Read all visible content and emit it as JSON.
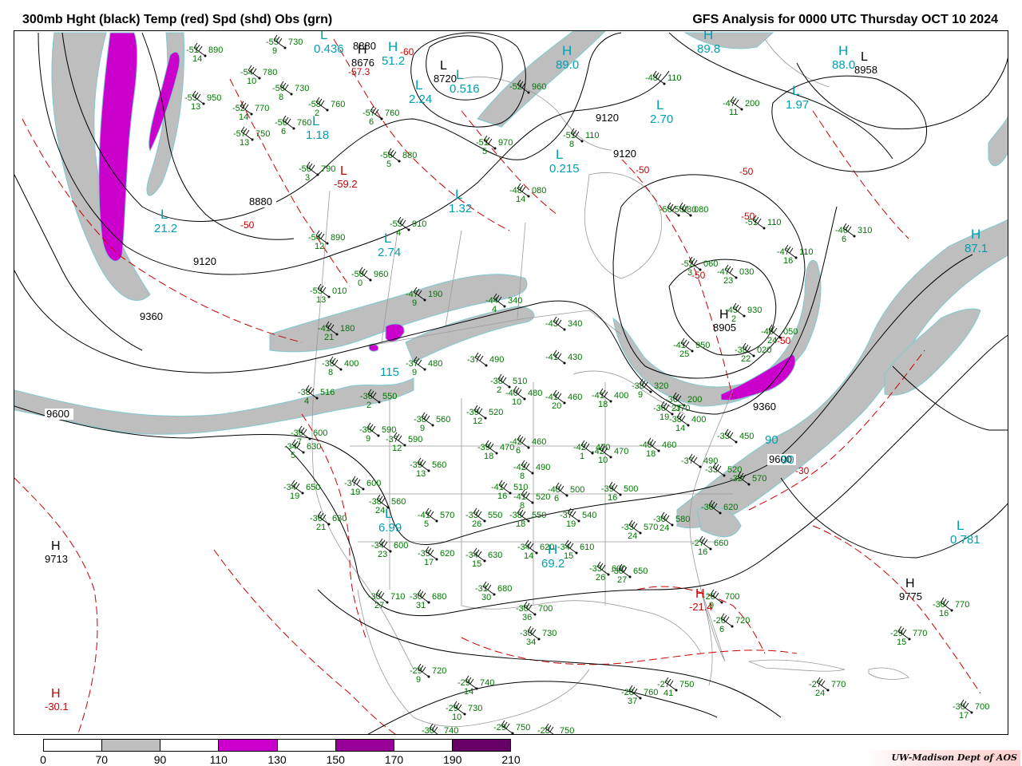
{
  "header": {
    "title_left": "300mb Hght (black) Temp (red) Spd (shd) Obs (grn)",
    "title_right": "GFS Analysis for 0000 UTC Thursday  OCT 10 2024"
  },
  "legend": {
    "labels": [
      "0",
      "70",
      "90",
      "110",
      "130",
      "150",
      "170",
      "190",
      "210"
    ],
    "colors": [
      "#ffffff",
      "#bebebe",
      "#ffffff",
      "#cc00cc",
      "#ffffff",
      "#990099",
      "#ffffff",
      "#660066"
    ]
  },
  "credit": "UW-Madison   Dept of AOS",
  "colors": {
    "height": "#000000",
    "temp": "#cc0000",
    "speed_label": "#00a0b0",
    "obs": "#007700",
    "boundary": "#999999"
  },
  "height_labels": [
    "8880",
    "9120",
    "9360",
    "9600",
    "9120",
    "9120",
    "8880",
    "9360",
    "9600"
  ],
  "centers": [
    {
      "type": "H",
      "value": "9713",
      "color": "black"
    },
    {
      "type": "H",
      "value": "9775",
      "color": "black"
    },
    {
      "type": "H",
      "value": "-30.1",
      "color": "red"
    },
    {
      "type": "L",
      "value": "8958",
      "color": "black"
    },
    {
      "type": "H",
      "value": "8905",
      "color": "black"
    },
    {
      "type": "L",
      "value": "8720",
      "color": "black"
    },
    {
      "type": "H",
      "value": "8676",
      "color": "black"
    },
    {
      "type": "H",
      "value": "-21.4",
      "color": "red"
    },
    {
      "type": "L",
      "value": "-59.2",
      "color": "red"
    }
  ],
  "speed_centers": [
    {
      "type": "L",
      "value": "21.2"
    },
    {
      "type": "L",
      "value": "2.74"
    },
    {
      "type": "L",
      "value": "1.18"
    },
    {
      "type": "L",
      "value": "2.24"
    },
    {
      "type": "L",
      "value": "1.32"
    },
    {
      "type": "L",
      "value": "0.215"
    },
    {
      "type": "L",
      "value": "2.70"
    },
    {
      "type": "L",
      "value": "1.97"
    },
    {
      "type": "H",
      "value": "88.0"
    },
    {
      "type": "H",
      "value": "89.0"
    },
    {
      "type": "H",
      "value": "87.1"
    },
    {
      "type": "L",
      "value": "6.99"
    },
    {
      "type": "H",
      "value": "69.2"
    },
    {
      "type": "L",
      "value": "0.781"
    },
    {
      "type": "H",
      "value": "51.2"
    },
    {
      "type": "L",
      "value": "0.436"
    },
    {
      "type": "L",
      "value": "0.516"
    },
    {
      "type": "H",
      "value": "89.8"
    },
    {
      "type": "",
      "value": "90"
    },
    {
      "type": "",
      "value": "90"
    },
    {
      "type": "",
      "value": "115"
    }
  ],
  "temp_labels": [
    "-50",
    "-50",
    "-50",
    "-50",
    "-50",
    "-30",
    "-57.3",
    "-60",
    "-50"
  ],
  "observations": [
    {
      "t": "-55",
      "h": "730",
      "td": "9"
    },
    {
      "t": "-51",
      "h": "890",
      "td": "14"
    },
    {
      "t": "-54",
      "h": "780",
      "td": "10"
    },
    {
      "t": "-56",
      "h": "730",
      "td": "8"
    },
    {
      "t": "-53",
      "h": "950",
      "td": "13"
    },
    {
      "t": "-52",
      "h": "770",
      "td": "14"
    },
    {
      "t": "-58",
      "h": "760",
      "td": "2"
    },
    {
      "t": "-56",
      "h": "760",
      "td": "6"
    },
    {
      "t": "-57",
      "h": "750",
      "td": "13"
    },
    {
      "t": "-57",
      "h": "760",
      "td": "6"
    },
    {
      "t": "-56",
      "h": "790",
      "td": "3"
    },
    {
      "t": "-56",
      "h": "880",
      "td": "5"
    },
    {
      "t": "-51",
      "h": "970",
      "td": "5"
    },
    {
      "t": "-48",
      "h": "080",
      "td": "14"
    },
    {
      "t": "-53",
      "h": "910",
      "td": "4"
    },
    {
      "t": "-54",
      "h": "890",
      "td": "12"
    },
    {
      "t": "-50",
      "h": "960",
      "td": "0"
    },
    {
      "t": "-52",
      "h": "960",
      "td": ""
    },
    {
      "t": "-51",
      "h": "110",
      "td": "8"
    },
    {
      "t": "-48",
      "h": "110",
      "td": ""
    },
    {
      "t": "-47",
      "h": "200",
      "td": "11"
    },
    {
      "t": "-50",
      "h": "080",
      "td": ""
    },
    {
      "t": "-50",
      "h": "080",
      "td": ""
    },
    {
      "t": "-51",
      "h": "110",
      "td": ""
    },
    {
      "t": "-52",
      "h": "060",
      "td": "3"
    },
    {
      "t": "-47",
      "h": "030",
      "td": "23"
    },
    {
      "t": "-47",
      "h": "110",
      "td": "16"
    },
    {
      "t": "-46",
      "h": "310",
      "td": "6"
    },
    {
      "t": "-53",
      "h": "010",
      "td": "13"
    },
    {
      "t": "-47",
      "h": "190",
      "td": "9"
    },
    {
      "t": "-44",
      "h": "340",
      "td": "4"
    },
    {
      "t": "-43",
      "h": "340",
      "td": ""
    },
    {
      "t": "-41",
      "h": "180",
      "td": "21"
    },
    {
      "t": "-41",
      "h": "950",
      "td": "25"
    },
    {
      "t": "-45",
      "h": "930",
      "td": "2"
    },
    {
      "t": "-40",
      "h": "050",
      "td": "24"
    },
    {
      "t": "-38",
      "h": "020",
      "td": "22"
    },
    {
      "t": "-38",
      "h": "400",
      "td": "8"
    },
    {
      "t": "-37",
      "h": "480",
      "td": "9"
    },
    {
      "t": "-37",
      "h": "490",
      "td": ""
    },
    {
      "t": "-41",
      "h": "430",
      "td": ""
    },
    {
      "t": "-38",
      "h": "510",
      "td": "2"
    },
    {
      "t": "-40",
      "h": "480",
      "td": "10"
    },
    {
      "t": "-41",
      "h": "460",
      "td": "20"
    },
    {
      "t": "-41",
      "h": "400",
      "td": "18"
    },
    {
      "t": "-38",
      "h": "320",
      "td": "9"
    },
    {
      "t": "-36",
      "h": "200",
      "td": "27"
    },
    {
      "t": "-36",
      "h": "370",
      "td": "19"
    },
    {
      "t": "-38",
      "h": "516",
      "td": "4"
    },
    {
      "t": "-36",
      "h": "550",
      "td": "2"
    },
    {
      "t": "-38",
      "h": "560",
      "td": "9"
    },
    {
      "t": "-39",
      "h": "520",
      "td": "12"
    },
    {
      "t": "-36",
      "h": "600",
      "td": "7"
    },
    {
      "t": "-36",
      "h": "590",
      "td": "9"
    },
    {
      "t": "-37",
      "h": "590",
      "td": "12"
    },
    {
      "t": "-34",
      "h": "630",
      "td": "5"
    },
    {
      "t": "-39",
      "h": "470",
      "td": "18"
    },
    {
      "t": "-42",
      "h": "460",
      "td": "6"
    },
    {
      "t": "-42",
      "h": "470",
      "td": "1"
    },
    {
      "t": "-42",
      "h": "470",
      "td": "10"
    },
    {
      "t": "-40",
      "h": "460",
      "td": "18"
    },
    {
      "t": "-38",
      "h": "400",
      "td": "14"
    },
    {
      "t": "-39",
      "h": "560",
      "td": "13"
    },
    {
      "t": "-42",
      "h": "490",
      "td": "8"
    },
    {
      "t": "-41",
      "h": "510",
      "td": "16"
    },
    {
      "t": "-41",
      "h": "520",
      "td": "8"
    },
    {
      "t": "-40",
      "h": "500",
      "td": "6"
    },
    {
      "t": "-39",
      "h": "500",
      "td": "16"
    },
    {
      "t": "-37",
      "h": "490",
      "td": ""
    },
    {
      "t": "-33",
      "h": "520",
      "td": ""
    },
    {
      "t": "-32",
      "h": "570",
      "td": ""
    },
    {
      "t": "-33",
      "h": "450",
      "td": ""
    },
    {
      "t": "-34",
      "h": "650",
      "td": "19"
    },
    {
      "t": "-37",
      "h": "600",
      "td": "19"
    },
    {
      "t": "-38",
      "h": "560",
      "td": "24"
    },
    {
      "t": "-36",
      "h": "630",
      "td": "21"
    },
    {
      "t": "-41",
      "h": "570",
      "td": "5"
    },
    {
      "t": "-33",
      "h": "550",
      "td": "26"
    },
    {
      "t": "-38",
      "h": "550",
      "td": "18"
    },
    {
      "t": "-37",
      "h": "540",
      "td": "19"
    },
    {
      "t": "-33",
      "h": "570",
      "td": "24"
    },
    {
      "t": "-30",
      "h": "580",
      "td": "24"
    },
    {
      "t": "-30",
      "h": "620",
      "td": ""
    },
    {
      "t": "-34",
      "h": "600",
      "td": "23"
    },
    {
      "t": "-35",
      "h": "620",
      "td": "17"
    },
    {
      "t": "-34",
      "h": "630",
      "td": "15"
    },
    {
      "t": "-34",
      "h": "620",
      "td": "14"
    },
    {
      "t": "-34",
      "h": "610",
      "td": "15"
    },
    {
      "t": "-33",
      "h": "600",
      "td": "26"
    },
    {
      "t": "-30",
      "h": "650",
      "td": "27"
    },
    {
      "t": "-27",
      "h": "660",
      "td": "16"
    },
    {
      "t": "-30",
      "h": "710",
      "td": "27"
    },
    {
      "t": "-30",
      "h": "680",
      "td": "31"
    },
    {
      "t": "-31",
      "h": "680",
      "td": "30"
    },
    {
      "t": "-30",
      "h": "700",
      "td": "36"
    },
    {
      "t": "-30",
      "h": "730",
      "td": "34"
    },
    {
      "t": "-26",
      "h": "700",
      "td": "9"
    },
    {
      "t": "-26",
      "h": "720",
      "td": "6"
    },
    {
      "t": "-29",
      "h": "720",
      "td": "9"
    },
    {
      "t": "-29",
      "h": "740",
      "td": "14"
    },
    {
      "t": "-29",
      "h": "730",
      "td": "10"
    },
    {
      "t": "-30",
      "h": "740",
      "td": ""
    },
    {
      "t": "-29",
      "h": "750",
      "td": ""
    },
    {
      "t": "-28",
      "h": "750",
      "td": ""
    },
    {
      "t": "-28",
      "h": "760",
      "td": "37"
    },
    {
      "t": "-27",
      "h": "750",
      "td": "41"
    },
    {
      "t": "-27",
      "h": "770",
      "td": "24"
    },
    {
      "t": "-29",
      "h": "770",
      "td": "15"
    },
    {
      "t": "-30",
      "h": "770",
      "td": "16"
    },
    {
      "t": "-30",
      "h": "700",
      "td": "17"
    }
  ]
}
